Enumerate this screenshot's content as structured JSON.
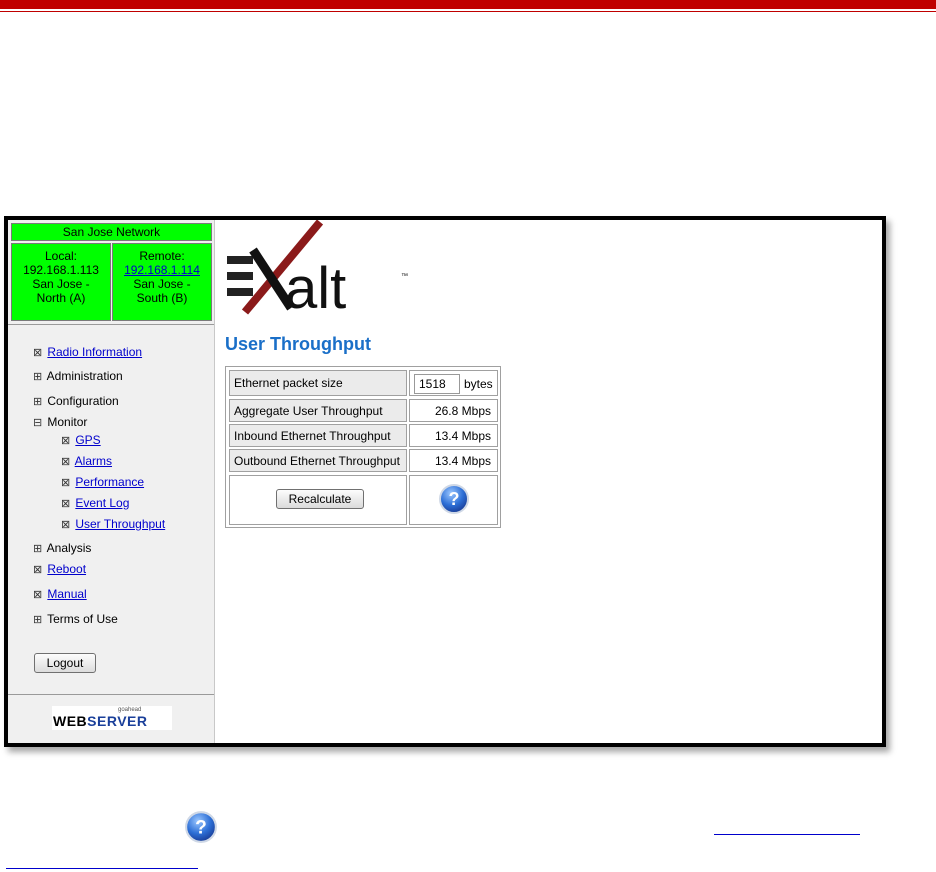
{
  "sidebar": {
    "network_name": "San Jose Network",
    "local": {
      "label": "Local:",
      "ip": "192.168.1.113",
      "name_line1": "San Jose -",
      "name_line2": "North (A)"
    },
    "remote": {
      "label": "Remote:",
      "ip": "192.168.1.114",
      "name_line1": "San Jose -",
      "name_line2": "South (B)"
    },
    "menu": {
      "radio_information": "Radio Information",
      "administration": "Administration",
      "configuration": "Configuration",
      "monitor": "Monitor",
      "gps": "GPS",
      "alarms": "Alarms",
      "performance": "Performance",
      "event_log": "Event Log",
      "user_throughput": "User Throughput",
      "analysis": "Analysis",
      "reboot": "Reboot",
      "manual": "Manual",
      "terms_of_use": "Terms of Use"
    },
    "logout_label": "Logout",
    "webserver_logo": {
      "small": "goahead",
      "web": "WEB",
      "server": "SERVER"
    }
  },
  "content": {
    "logo_text": "alt",
    "title": "User Throughput",
    "rows": {
      "packet_size": {
        "label": "Ethernet packet size",
        "value": "1518",
        "unit": "bytes"
      },
      "aggregate": {
        "label": "Aggregate User Throughput",
        "value": "26.8 Mbps"
      },
      "inbound": {
        "label": "Inbound Ethernet Throughput",
        "value": "13.4 Mbps"
      },
      "outbound": {
        "label": "Outbound Ethernet Throughput",
        "value": "13.4 Mbps"
      }
    },
    "recalculate_label": "Recalculate"
  },
  "colors": {
    "accent_red": "#c00000",
    "site_green": "#00ff00",
    "title_blue": "#1a6fc8",
    "link_blue": "#0000cc"
  }
}
